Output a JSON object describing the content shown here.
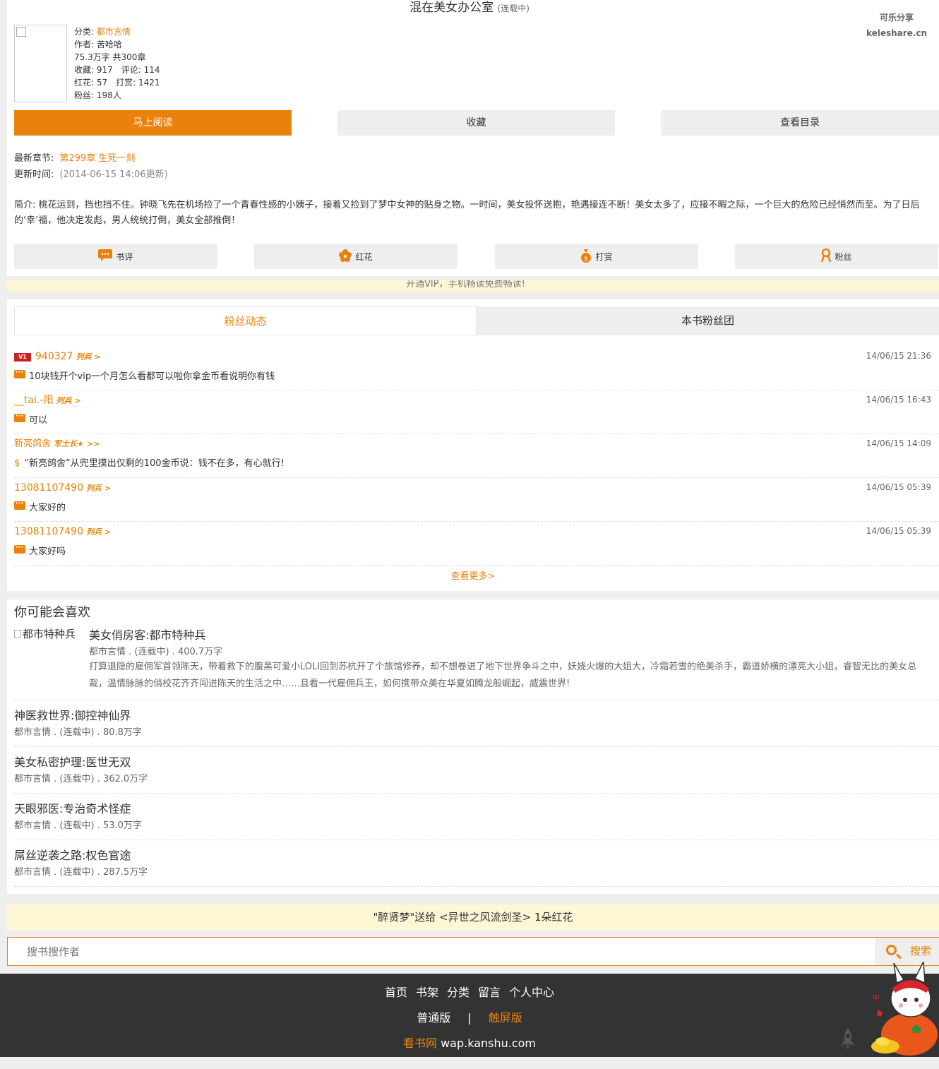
{
  "book": {
    "title": "混在美女办公室",
    "status": "(连载中)",
    "category_label": "分类: ",
    "category": "都市言情",
    "author": "作者: 苦哈哈",
    "words": "75.3万字 共300章",
    "favorites": "收藏: 917",
    "comments": "评论: 114",
    "flowers": "红花: 57",
    "rewards": "打赏: 1421",
    "fans": "粉丝: 198人"
  },
  "share": {
    "line1": "可乐分享",
    "line2": "keleshare.cn"
  },
  "buttons": {
    "read": "马上阅读",
    "collect": "收藏",
    "toc": "查看目录"
  },
  "latest": {
    "chapter_label": "最新章节:",
    "chapter": "第299章 生死一刻",
    "update_label": "更新时间:",
    "update": "(2014-06-15 14:06更新)"
  },
  "intro": "简介:  桃花运到，挡也挡不住。钟晓飞先在机场捡了一个青春性感的小姨子，接着又捡到了梦中女神的贴身之物。一时间，美女投怀送抱，艳遇接连不断！美女太多了，应接不暇之际，一个巨大的危险已经悄然而至。为了日后的‘幸’福，他决定发彪，男人统统打倒，美女全部推倒！",
  "actions": [
    "书评",
    "红花",
    "打赏",
    "粉丝"
  ],
  "strip_text": "开通VIP，手机畅读免费畅读!",
  "tabs": {
    "active": "粉丝动态",
    "inactive": "本书粉丝团"
  },
  "fan_feed": [
    {
      "user": "940327",
      "badge": "列兵",
      "time": "14/06/15 21:36",
      "msg": "10块钱开个vip一个月怎么看都可以啦你拿金币看说明你有钱"
    },
    {
      "user": "__tai.-阳",
      "badge": "列兵",
      "time": "14/06/15 16:43",
      "msg": "可以"
    },
    {
      "user": "新亮鸽舍",
      "badge": "军士长★",
      "time": "14/06/15 14:09",
      "msg": "“新亮鸽舍”从兜里摸出仅剩的100金币说：钱不在多，有心就行!"
    },
    {
      "user": "13081107490",
      "badge": "列兵",
      "time": "14/06/15 05:39",
      "msg": "大家好的"
    },
    {
      "user": "13081107490",
      "badge": "列兵",
      "time": "14/06/15 05:39",
      "msg": "大家好吗"
    }
  ],
  "more": "查看更多>",
  "recommend": {
    "heading": "你可能会喜欢",
    "first": {
      "img_alt": "都市特种兵",
      "title": "美女俏房客:都市特种兵",
      "sub": "都市言情 . (连载中) . 400.7万字",
      "desc": "打算退隐的雇佣军首领陈天，带着救下的腹黑可爱小LOLI回到苏杭开了个旅馆修养，却不想卷进了地下世界争斗之中，妖娆火爆的大姐大，冷霜若雪的绝美杀手，霸道娇横的漂亮大小姐，睿智无比的美女总裁，温情脉脉的俏校花齐齐闯进陈天的生活之中……且看一代雇佣兵王，如何携带众美在华夏如腾龙般崛起，威震世界!"
    },
    "items": [
      {
        "title": "神医救世界:御控神仙界",
        "sub": "都市言情 . (连载中) . 80.8万字"
      },
      {
        "title": "美女私密护理:医世无双",
        "sub": "都市言情 . (连载中) . 362.0万字"
      },
      {
        "title": "天眼邪医:专治奇术怪症",
        "sub": "都市言情 . (连载中) . 53.0万字"
      },
      {
        "title": "屌丝逆袭之路:权色官途",
        "sub": "都市言情 . (连载中) . 287.5万字"
      }
    ]
  },
  "notice": "\"醉贤梦\"送给 <异世之风流剑圣> 1朵红花",
  "search": {
    "placeholder": "搜书搜作者",
    "button": "搜索"
  },
  "footer": {
    "nav": [
      "首页",
      "书架",
      "分类",
      "留言",
      "个人中心"
    ],
    "normal": "普通版",
    "sep": "|",
    "touch": "触屏版",
    "site_name": "看书网",
    "site_url": "wap.kanshu.com"
  },
  "colors": {
    "accent": "#e8820c",
    "footer_bg": "#333333",
    "notice_bg": "#fdf7d6"
  }
}
